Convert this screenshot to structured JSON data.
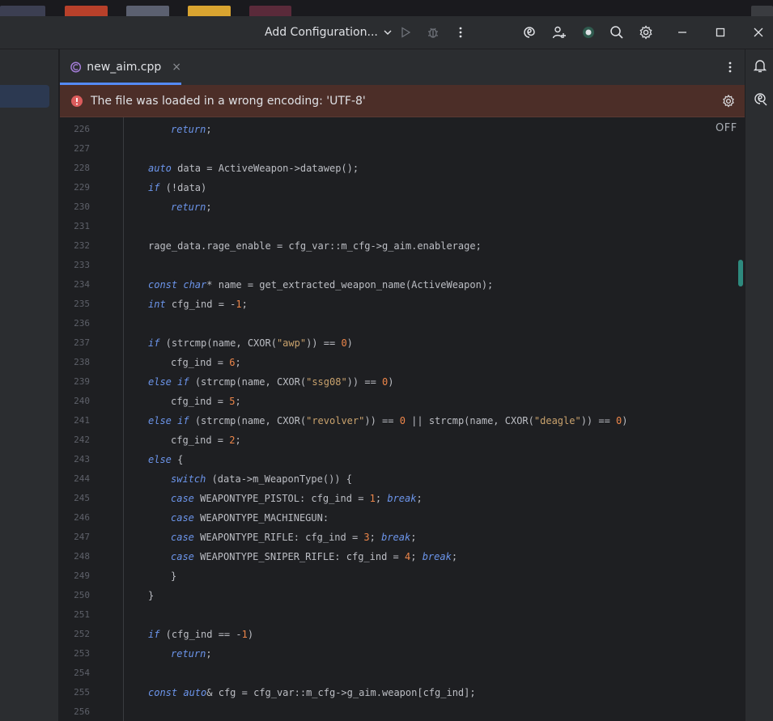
{
  "window": {
    "run_config_label": "Add Configuration...",
    "colors": {
      "accent": "#548af7",
      "error": "#db5c5c",
      "banner_bg": "#4c2e28"
    }
  },
  "tabs": [
    {
      "label": "new_aim.cpp",
      "icon": "cpp-file-icon",
      "close": "×"
    }
  ],
  "banner": {
    "message": "The file was loaded in a wrong encoding: 'UTF-8'"
  },
  "editor": {
    "inlay_status": "OFF",
    "lines": [
      {
        "n": "226",
        "code": "return;"
      },
      {
        "n": "227",
        "code": ""
      },
      {
        "n": "228",
        "code": "auto data = ActiveWeapon->datawep();"
      },
      {
        "n": "229",
        "code": "if (!data)"
      },
      {
        "n": "230",
        "code": "return;"
      },
      {
        "n": "231",
        "code": ""
      },
      {
        "n": "232",
        "code": "rage_data.rage_enable = cfg_var::m_cfg->g_aim.enablerage;"
      },
      {
        "n": "233",
        "code": ""
      },
      {
        "n": "234",
        "code": "const char* name = get_extracted_weapon_name(ActiveWeapon);"
      },
      {
        "n": "235",
        "code": "int cfg_ind = -1;"
      },
      {
        "n": "236",
        "code": ""
      },
      {
        "n": "237",
        "code": "if (strcmp(name, CXOR(\"awp\")) == 0)"
      },
      {
        "n": "238",
        "code": "cfg_ind = 6;"
      },
      {
        "n": "239",
        "code": "else if (strcmp(name, CXOR(\"ssg08\")) == 0)"
      },
      {
        "n": "240",
        "code": "cfg_ind = 5;"
      },
      {
        "n": "241",
        "code": "else if (strcmp(name, CXOR(\"revolver\")) == 0 || strcmp(name, CXOR(\"deagle\")) == 0)"
      },
      {
        "n": "242",
        "code": "cfg_ind = 2;"
      },
      {
        "n": "243",
        "code": "else {"
      },
      {
        "n": "244",
        "code": "switch (data->m_WeaponType()) {"
      },
      {
        "n": "245",
        "code": "case WEAPONTYPE_PISTOL: cfg_ind = 1; break;"
      },
      {
        "n": "246",
        "code": "case WEAPONTYPE_MACHINEGUN:"
      },
      {
        "n": "247",
        "code": "case WEAPONTYPE_RIFLE: cfg_ind = 3; break;"
      },
      {
        "n": "248",
        "code": "case WEAPONTYPE_SNIPER_RIFLE: cfg_ind = 4; break;"
      },
      {
        "n": "249",
        "code": "}"
      },
      {
        "n": "250",
        "code": "}"
      },
      {
        "n": "251",
        "code": ""
      },
      {
        "n": "252",
        "code": "if (cfg_ind == -1)"
      },
      {
        "n": "253",
        "code": "return;"
      },
      {
        "n": "254",
        "code": ""
      },
      {
        "n": "255",
        "code": "const auto& cfg = cfg_var::m_cfg->g_aim.weapon[cfg_ind];"
      },
      {
        "n": "256",
        "code": ""
      }
    ]
  }
}
